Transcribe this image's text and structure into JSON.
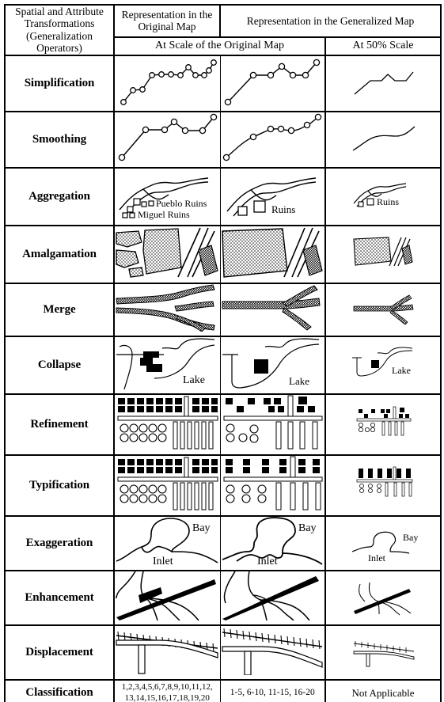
{
  "table": {
    "header": {
      "row_label_header": "Spatial and Attribute Transformations (Generalization Operators)",
      "col_original": "Representation in the Original Map",
      "col_generalized": "Representation in the Generalized Map",
      "sub_full_scale": "At Scale of the Original Map",
      "sub_half_scale": "At 50% Scale"
    },
    "rows": [
      {
        "operator": "Simplification",
        "original": {
          "kind": "vertex-line",
          "vertices": 14,
          "label": ""
        },
        "generalized_full": {
          "kind": "vertex-line",
          "vertices": 8,
          "label": ""
        },
        "generalized_half": {
          "kind": "plain-line",
          "label": ""
        }
      },
      {
        "operator": "Smoothing",
        "original": {
          "kind": "angular-vertex-line",
          "vertices": 7,
          "label": ""
        },
        "generalized_full": {
          "kind": "smoothed-vertex-line",
          "vertices": 7,
          "label": ""
        },
        "generalized_half": {
          "kind": "smooth-line",
          "label": ""
        }
      },
      {
        "operator": "Aggregation",
        "original": {
          "kind": "ruins-symbols",
          "labels": [
            "Pueblo Ruins",
            "Miguel Ruins"
          ],
          "symbol_count": 6
        },
        "generalized_full": {
          "kind": "ruins-symbols",
          "labels": [
            "Ruins"
          ],
          "symbol_count": 2
        },
        "generalized_half": {
          "kind": "ruins-symbols",
          "labels": [
            "Ruins"
          ],
          "symbol_count": 2
        }
      },
      {
        "operator": "Amalgamation",
        "original": {
          "kind": "stippled-polygons",
          "polygon_count": 4
        },
        "generalized_full": {
          "kind": "stippled-polygons",
          "polygon_count": 1
        },
        "generalized_half": {
          "kind": "stippled-polygons",
          "polygon_count": 1
        }
      },
      {
        "operator": "Merge",
        "original": {
          "kind": "parallel-roads",
          "line_count": 2
        },
        "generalized_full": {
          "kind": "merged-road",
          "line_count": 1
        },
        "generalized_half": {
          "kind": "merged-road",
          "line_count": 1
        }
      },
      {
        "operator": "Collapse",
        "original": {
          "kind": "lake-area",
          "label": "Lake"
        },
        "generalized_full": {
          "kind": "lake-point",
          "label": "Lake"
        },
        "generalized_half": {
          "kind": "lake-point",
          "label": "Lake"
        }
      },
      {
        "operator": "Refinement",
        "original": {
          "kind": "buildings-trees-wells",
          "buildings": 22,
          "trees": 10,
          "wells": 9
        },
        "generalized_full": {
          "kind": "buildings-trees-wells",
          "buildings": 11,
          "trees": 5,
          "wells": 5
        },
        "generalized_half": {
          "kind": "buildings-trees-wells",
          "buildings": 8,
          "trees": 4,
          "wells": 4
        }
      },
      {
        "operator": "Typification",
        "original": {
          "kind": "buildings-trees-wells",
          "buildings": 22,
          "trees": 10,
          "wells": 9
        },
        "generalized_full": {
          "kind": "buildings-trees-wells",
          "buildings": 12,
          "trees": 6,
          "wells": 5
        },
        "generalized_half": {
          "kind": "buildings-trees-wells",
          "buildings": 7,
          "trees": 3,
          "wells": 3
        }
      },
      {
        "operator": "Exaggeration",
        "original": {
          "kind": "bay-inlet",
          "labels": [
            "Bay",
            "Inlet"
          ]
        },
        "generalized_full": {
          "kind": "bay-inlet-exaggerated",
          "labels": [
            "Bay",
            "Inlet"
          ]
        },
        "generalized_half": {
          "kind": "bay-inlet-exaggerated",
          "labels": [
            "Bay",
            "Inlet"
          ]
        }
      },
      {
        "operator": "Enhancement",
        "original": {
          "kind": "road-stream-junction",
          "label": ""
        },
        "generalized_full": {
          "kind": "road-stream-junction-enhanced",
          "label": ""
        },
        "generalized_half": {
          "kind": "road-stream-junction-enhanced",
          "label": ""
        }
      },
      {
        "operator": "Displacement",
        "original": {
          "kind": "railway-road-overlap",
          "label": ""
        },
        "generalized_full": {
          "kind": "railway-road-displaced",
          "label": ""
        },
        "generalized_half": {
          "kind": "railway-road-displaced",
          "label": ""
        }
      },
      {
        "operator": "Classification",
        "original": {
          "kind": "text",
          "label": "1,2,3,4,5,6,7,8,9,10,11,12, 13,14,15,16,17,18,19,20"
        },
        "generalized_full": {
          "kind": "text",
          "label": "1-5, 6-10, 11-15, 16-20"
        },
        "generalized_half": {
          "kind": "text",
          "label": "Not Applicable"
        }
      }
    ]
  },
  "colors": {
    "ink": "#000000",
    "paper": "#ffffff",
    "stipple": "#000000",
    "hatch": "#555555"
  }
}
